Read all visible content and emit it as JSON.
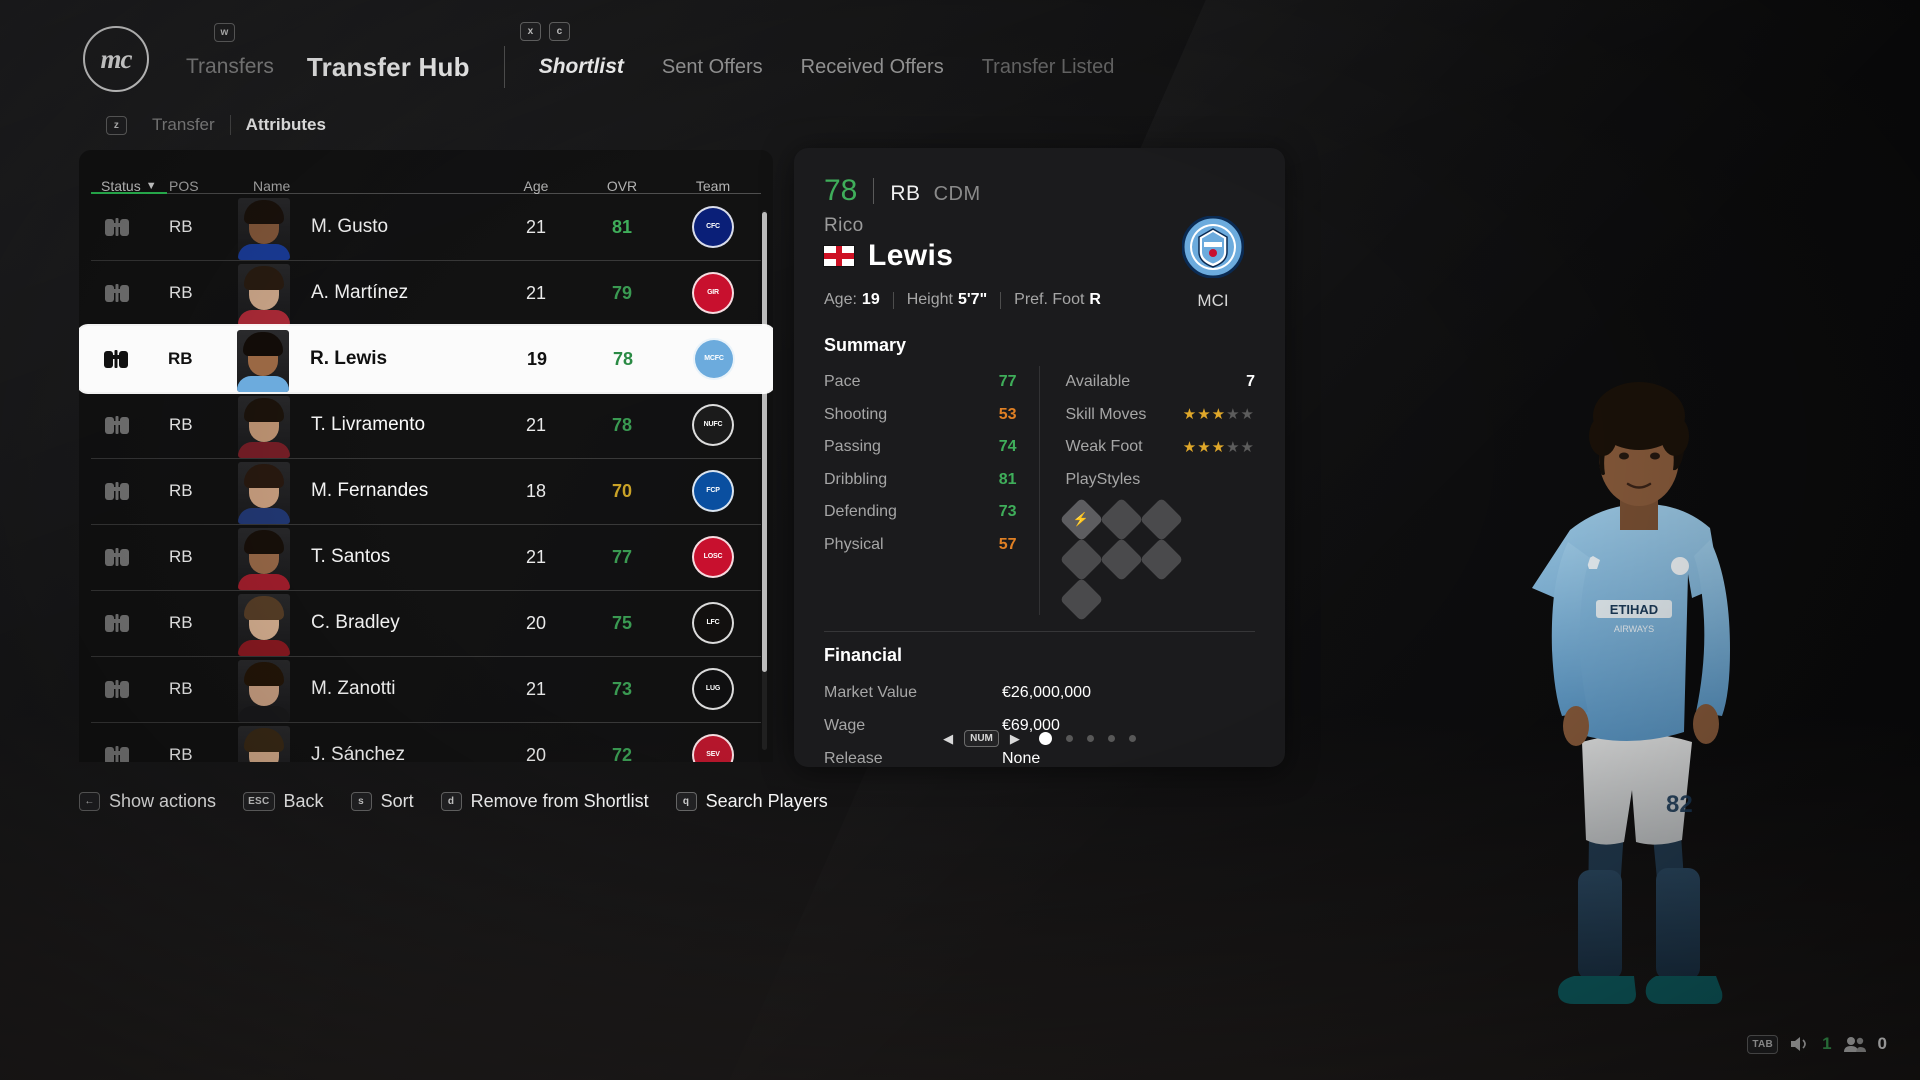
{
  "header": {
    "crest_text": "mc",
    "breadcrumb": "Transfers",
    "title": "Transfer Hub",
    "breadcrumb_key": "w",
    "tabs_keys": [
      "x",
      "c"
    ],
    "tabs": [
      {
        "label": "Shortlist",
        "state": "active"
      },
      {
        "label": "Sent Offers",
        "state": "normal"
      },
      {
        "label": "Received Offers",
        "state": "normal"
      },
      {
        "label": "Transfer Listed",
        "state": "disabled"
      }
    ],
    "subtabs_key": "z",
    "subtabs": [
      {
        "label": "Transfer",
        "state": "normal"
      },
      {
        "label": "Attributes",
        "state": "active"
      }
    ]
  },
  "table": {
    "columns": {
      "status": "Status",
      "sort_caret": "▼",
      "pos": "POS",
      "name": "Name",
      "age": "Age",
      "ovr": "OVR",
      "team": "Team"
    },
    "sort_column": "Status",
    "sort_accent": "#2ecc5a",
    "rows": [
      {
        "status_icon": "binoculars-icon",
        "pos": "RB",
        "name": "M. Gusto",
        "age": "21",
        "ovr": "81",
        "ovr_color": "#3fae5a",
        "team": "Chelsea",
        "crest_bg": "#0a1f78",
        "crest_txt": "CFC",
        "hair": "#1b120c",
        "skin": "#8a5c3d",
        "torso": "#1b3fa0",
        "selected": false
      },
      {
        "status_icon": "binoculars-icon",
        "pos": "RB",
        "name": "A. Martínez",
        "age": "21",
        "ovr": "79",
        "ovr_color": "#3a9a52",
        "team": "Girona",
        "crest_bg": "#c8102e",
        "crest_txt": "GIR",
        "hair": "#2b1d12",
        "skin": "#d8b091",
        "torso": "#b52c3a",
        "selected": false
      },
      {
        "status_icon": "binoculars-icon",
        "pos": "RB",
        "name": "R. Lewis",
        "age": "19",
        "ovr": "78",
        "ovr_color": "#2a8a44",
        "team": "Manchester City",
        "crest_bg": "#6CABDD",
        "crest_txt": "MCFC",
        "hair": "#120c08",
        "skin": "#9a6844",
        "torso": "#6CABDD",
        "selected": true
      },
      {
        "status_icon": "binoculars-icon",
        "pos": "RB",
        "name": "T. Livramento",
        "age": "21",
        "ovr": "78",
        "ovr_color": "#3a9a52",
        "team": "Newcastle United",
        "crest_bg": "#1b1b1b",
        "crest_txt": "NUFC",
        "hair": "#1d140c",
        "skin": "#c69a78",
        "torso": "#7a1f28",
        "selected": false
      },
      {
        "status_icon": "binoculars-icon",
        "pos": "RB",
        "name": "M. Fernandes",
        "age": "18",
        "ovr": "70",
        "ovr_color": "#c9a227",
        "team": "FC Porto",
        "crest_bg": "#0a4fa0",
        "crest_txt": "FCP",
        "hair": "#2a1a10",
        "skin": "#d0a484",
        "torso": "#233a78",
        "selected": false
      },
      {
        "status_icon": "binoculars-icon",
        "pos": "RB",
        "name": "T. Santos",
        "age": "21",
        "ovr": "77",
        "ovr_color": "#3a9a52",
        "team": "LOSC Lille",
        "crest_bg": "#c8102e",
        "crest_txt": "LOSC",
        "hair": "#18100a",
        "skin": "#9d6c4a",
        "torso": "#a81f2e",
        "selected": false
      },
      {
        "status_icon": "binoculars-icon",
        "pos": "RB",
        "name": "C. Bradley",
        "age": "20",
        "ovr": "75",
        "ovr_color": "#3a9a52",
        "team": "Liverpool",
        "crest_bg": "#12100f",
        "crest_txt": "LFC",
        "hair": "#5a4028",
        "skin": "#ddb595",
        "torso": "#8e1a22",
        "selected": false
      },
      {
        "status_icon": "binoculars-icon",
        "pos": "RB",
        "name": "M. Zanotti",
        "age": "21",
        "ovr": "73",
        "ovr_color": "#3a9a52",
        "team": "LUG",
        "crest_bg": "#0f0f10",
        "crest_txt": "LUG",
        "hair": "#241608",
        "skin": "#cfa486",
        "torso": "#1a1a1c",
        "selected": false
      },
      {
        "status_icon": "binoculars-icon",
        "pos": "RB",
        "name": "J. Sánchez",
        "age": "20",
        "ovr": "72",
        "ovr_color": "#3a9a52",
        "team": "Sevilla FC",
        "crest_bg": "#b6162c",
        "crest_txt": "SEV",
        "hair": "#3a2a16",
        "skin": "#d8ae8c",
        "torso": "#d8d8d8",
        "selected": false
      }
    ]
  },
  "player": {
    "ovr": "78",
    "position": "RB",
    "position_alt": "CDM",
    "first_name": "Rico",
    "last_name": "Lewis",
    "nationality_flag": "england-flag-icon",
    "club_crest": "manchester-city-crest-icon",
    "club_abbr": "MCI",
    "meta": {
      "age_label": "Age:",
      "age_value": "19",
      "height_label": "Height",
      "height_value": "5'7\"",
      "foot_label": "Pref. Foot",
      "foot_value": "R"
    },
    "summary_title": "Summary",
    "attributes": [
      {
        "label": "Pace",
        "value": "77",
        "tone": "green"
      },
      {
        "label": "Shooting",
        "value": "53",
        "tone": "orange"
      },
      {
        "label": "Passing",
        "value": "74",
        "tone": "green"
      },
      {
        "label": "Dribbling",
        "value": "81",
        "tone": "green"
      },
      {
        "label": "Defending",
        "value": "73",
        "tone": "green"
      },
      {
        "label": "Physical",
        "value": "57",
        "tone": "orange"
      }
    ],
    "extras": {
      "available_label": "Available",
      "available_value": "7",
      "skill_moves_label": "Skill Moves",
      "skill_moves": 3,
      "weak_foot_label": "Weak Foot",
      "weak_foot": 3,
      "star_max": 5,
      "playstyles_label": "PlayStyles",
      "playstyles_count": 7
    },
    "financial_title": "Financial",
    "financial": [
      {
        "label": "Market Value",
        "value": "€26,000,000"
      },
      {
        "label": "Wage",
        "value": "€69,000"
      },
      {
        "label": "Release",
        "value": "None"
      }
    ],
    "pager": {
      "left_arrow": "◀",
      "key": "NUM",
      "right_arrow": "▶",
      "pages": 5,
      "active_page": 1
    }
  },
  "action_bar": [
    {
      "key": "←",
      "label": "Show actions"
    },
    {
      "key": "ESC",
      "label": "Back"
    },
    {
      "key": "s",
      "label": "Sort"
    },
    {
      "key": "d",
      "label": "Remove from Shortlist"
    },
    {
      "key": "q",
      "label": "Search Players"
    }
  ],
  "hud": {
    "key": "TAB",
    "volume_icon": "speaker-icon",
    "volume_value": "1",
    "people_icon": "people-icon",
    "people_value": "0"
  },
  "colors": {
    "accent_green": "#3fae5a",
    "accent_orange": "#e08024",
    "accent_yellow": "#c9a227",
    "panel_bg": "#1b1b1d"
  }
}
